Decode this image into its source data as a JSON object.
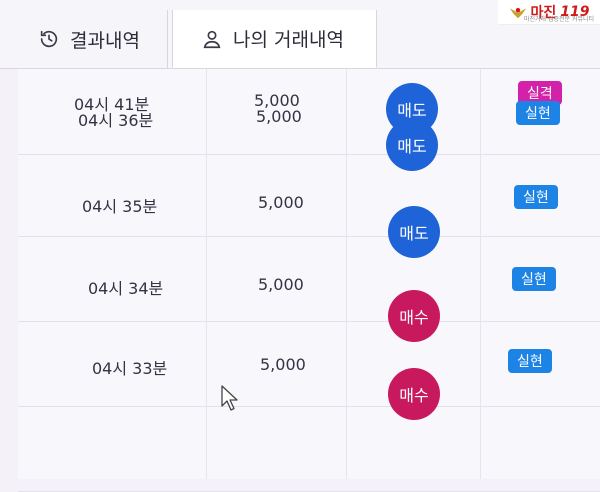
{
  "tabs": [
    {
      "label": "결과내역",
      "icon": "history-icon"
    },
    {
      "label": "나의 거래내역",
      "icon": "user-icon",
      "active": true
    }
  ],
  "brand": {
    "name": "마진",
    "suffix": "119",
    "tagline": "마진거래 검증전문 커뮤니티"
  },
  "colors": {
    "sell": "#1f63d9",
    "buy": "#c8195f",
    "fail_badge": "#d321a9",
    "real_badge": "#1d84e6"
  },
  "trades": [
    {
      "time": "04시 41분",
      "amount": "5,000",
      "side": "매도",
      "side_type": "sell",
      "result": "실격",
      "result_type": "fail"
    },
    {
      "time": "04시 36분",
      "amount": "5,000",
      "side": "매도",
      "side_type": "sell",
      "result": "실현",
      "result_type": "real"
    },
    {
      "time": "04시 35분",
      "amount": "5,000",
      "side": "매도",
      "side_type": "sell",
      "result": "실현",
      "result_type": "real"
    },
    {
      "time": "04시 34분",
      "amount": "5,000",
      "side": "매수",
      "side_type": "buy",
      "result": "실현",
      "result_type": "real"
    },
    {
      "time": "04시 33분",
      "amount": "5,000",
      "side": "매수",
      "side_type": "buy",
      "result": "실현",
      "result_type": "real"
    }
  ]
}
